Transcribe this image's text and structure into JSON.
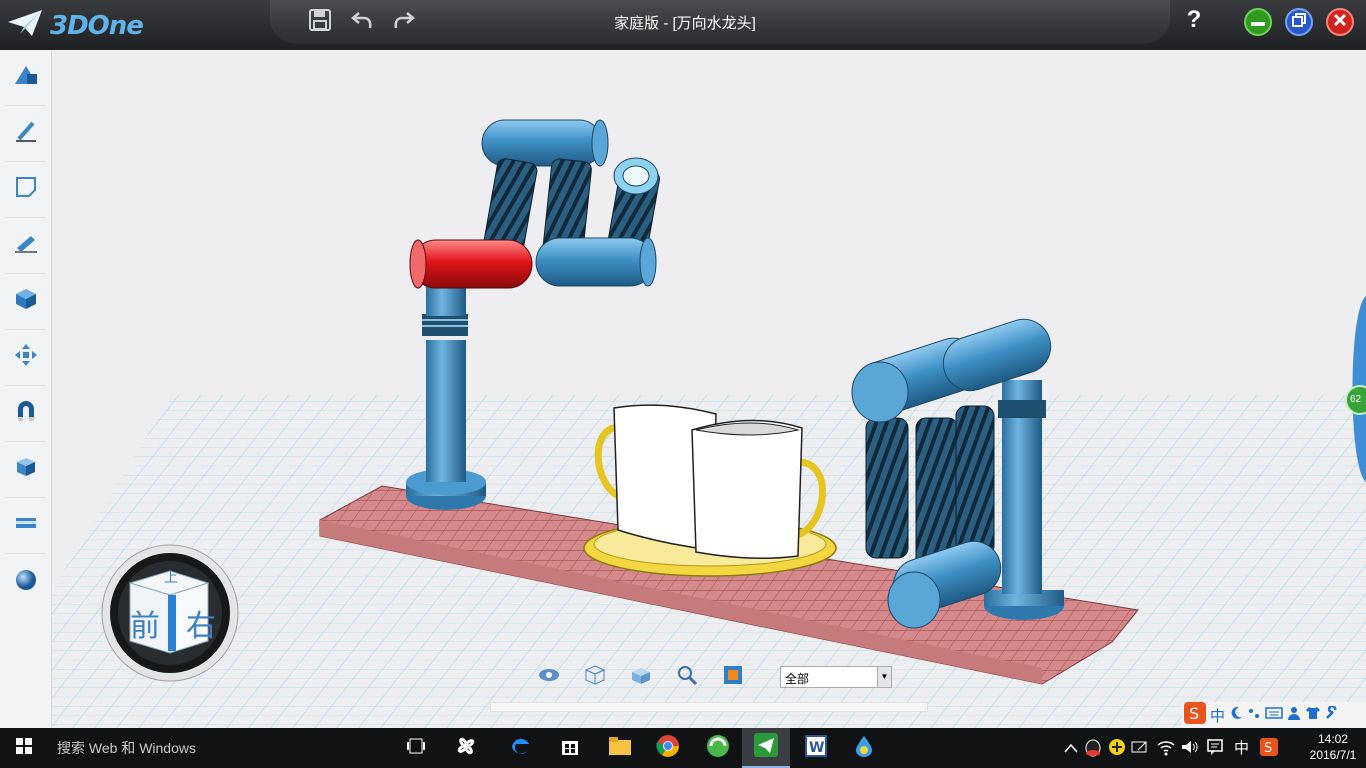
{
  "app": {
    "logo_text": "3DOne",
    "window_title": "家庭版 - [万向水龙头]"
  },
  "titlebar": {
    "help_label": "?",
    "icons": [
      "save-icon",
      "undo-icon",
      "redo-icon"
    ],
    "window_controls": [
      "minimize-icon",
      "restore-icon",
      "close-icon"
    ]
  },
  "left_toolbar": {
    "items": [
      "basic-shape-icon",
      "sketch-icon",
      "sketch-edit-icon",
      "feature-icon",
      "special-feature-icon",
      "move-icon",
      "combine-icon",
      "assembly-icon",
      "measure-icon",
      "render-icon"
    ]
  },
  "view_cube": {
    "top": "上",
    "front": "前",
    "right": "右"
  },
  "bottom_bar": {
    "icons": [
      "eye-icon",
      "wireframe-cube-icon",
      "shaded-cube-icon",
      "zoom-icon",
      "select-filter-icon"
    ],
    "filter_value": "全部"
  },
  "right_tab": {
    "badge": "62"
  },
  "ime": {
    "lang": "中",
    "items": [
      "sogou-icon",
      "lang-cn",
      "moon-icon",
      "punct-icon",
      "keyboard-icon",
      "user-icon",
      "shirt-icon",
      "wrench-icon"
    ]
  },
  "taskbar": {
    "search_placeholder": "搜索 Web 和 Windows",
    "apps": [
      "task-view-icon",
      "fan-icon",
      "edge-icon",
      "store-icon",
      "explorer-icon",
      "chrome-icon",
      "browser-360-icon",
      "3done-icon",
      "word-icon",
      "app-drop-icon"
    ],
    "tray_lang": "中",
    "time": "14:02",
    "date": "2016/7/1"
  },
  "colors": {
    "part_blue": "#3e8fc4",
    "part_dark": "#1f4f6f",
    "selected_red": "#e0141a",
    "base_pink": "#d98a8a",
    "cup_white": "#ffffff",
    "handle_yellow": "#e6c521",
    "accent": "#5fb3e8"
  }
}
